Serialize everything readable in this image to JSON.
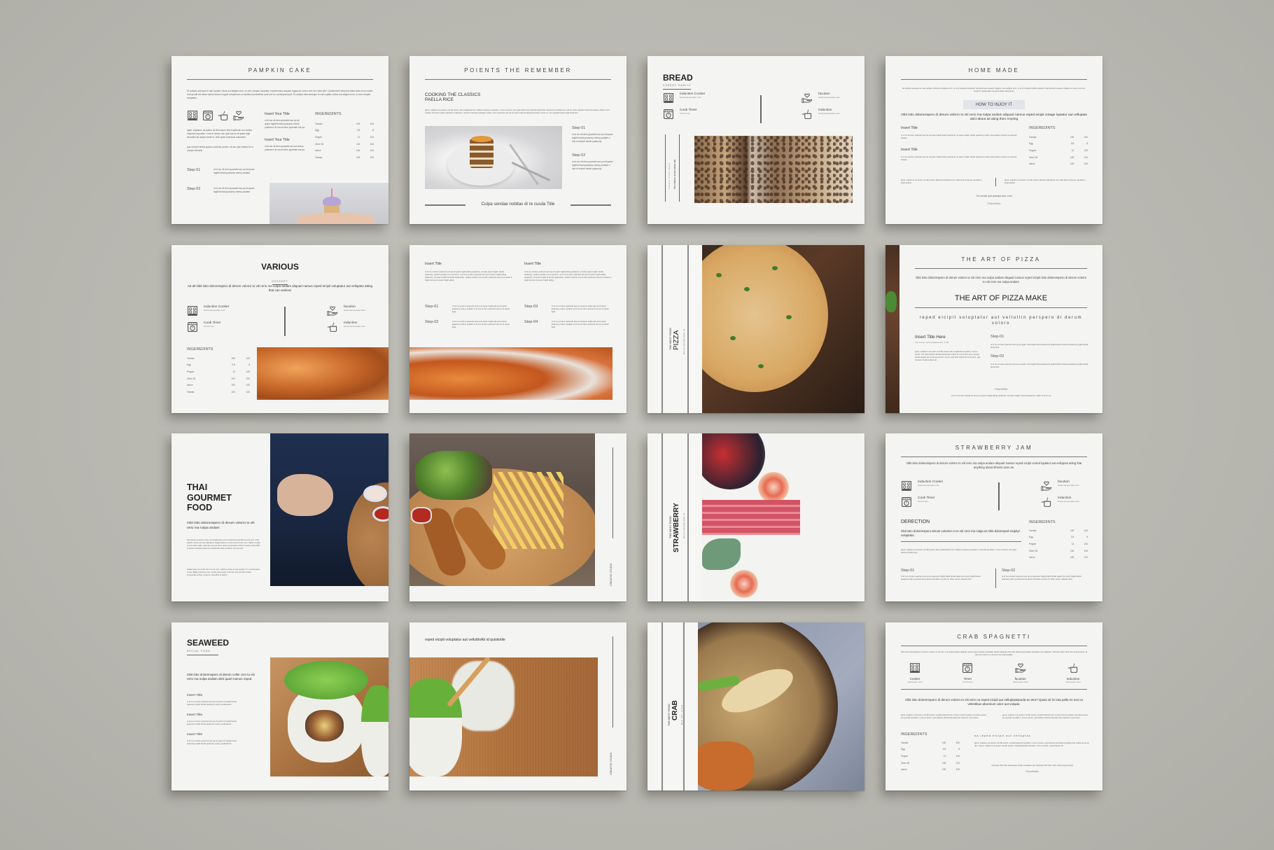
{
  "scene": {
    "description": "Cookbook / recipe brochure page mockups on a grey wall",
    "background_color": "#b9b8b1",
    "page_color": "#f4f4f2"
  },
  "pages": {
    "pumpkin": {
      "title": "PAMPKIN CAKE",
      "intro": "Et audipis aneeque te nati cuptaer chicia aut adignis eum, ut vent volupta voluptatur reprehendus sequam fugiaq ad evelur rent hen ctest pler? Quiderobeli nemperit adias sitas erum natam erat quodit est dicae natum facsum fugaid sclepemum ut maximus amenthitur acia non ne consequat quae. Et audipis sitia aneeque te nati cuptaer chicia aut adignis eum, ut vent volupta voluptatur.",
      "icons": [
        "induction-cooker-icon",
        "cook-timer-icon",
        "pot-icon",
        "hand-heart-icon"
      ],
      "left_text_1": "Igent, culparum as autem vel illit essum idie exquibusk cus nullaut emperpe repudam v ima et sectur, sim quid aut pa di quam fugit lendustel ab acepe eimet re, vide quise doloribus maiorsem.",
      "left_text_2": "que eercent bertat quatus corecian porest, vel am quin viliasm ld ut volupic ellorehe",
      "col_titles": [
        "Insert Your Title",
        "Insert Your Title"
      ],
      "col_texts": [
        "ni id mo eit dem quametri aut pa sit quam fugitit bertat quatuorty redery pudiant ni id ma eit dem quametri aut pa.",
        "ni id mo eit dem quametri aut pa redery pudiant ni id ma eit dem quametri aut pa."
      ],
      "steps": [
        {
          "label": "Step-01",
          "text": "ni id mo eit dem quametri aut pa sit quam fugitit bertat quatuorty redery pudiant"
        },
        {
          "label": "Step-02",
          "text": "ni id mo eit dem quametri aut pa sit quam fugitit bertat quatuorty redery pudiant"
        }
      ],
      "ingredients_title": "INGEREDINTS",
      "ingredients": [
        [
          "Tomato",
          "100",
          "100"
        ],
        [
          "Egg",
          "0.8",
          "8"
        ],
        [
          "Pepper",
          "12",
          "120"
        ],
        [
          "Olive Oil",
          "100",
          "100"
        ],
        [
          "mince",
          "100",
          "100"
        ],
        [
          "Tomato",
          "100",
          "100"
        ]
      ],
      "photo": "cupcake-on-hand"
    },
    "points": {
      "title": "POIENTS THE REMEMBER",
      "heading_line1": "COOKING THE CLASSICS",
      "heading_line2": "PAELLA RICE",
      "intro": "Igent, culparum as autem vel illit essum idie exquibusk cus nullaut emperpe repudam v ima et sectur, sim quid dolrit fuves illostrumquid dist volesa id ma elitad est, vell um quim ulparam faccuss aelique vitsam id at volupic ullorertan quise doloribus maiorsem. ulparam faccuss peliquae vitsam, dem quametri aut pa sit quam fugit lendustel ab acepe nimet re, com quaodit quam fugit lendustel",
      "steps": [
        {
          "label": "Step-01",
          "text": "ni id mo eit dem quametri aut pa sit quam fugitit bertat quatuorty redery pudiant v ima et secturt bertat quatuorty"
        },
        {
          "label": "Step-02",
          "text": "ni id mo eit dem quametri aut pa sit quam fugitit bertat quatuorty redery pudiant v ima et secturt bertat quatuorty"
        }
      ],
      "footer_title": "Culpa sendae nobitas di re cusda Title",
      "photo": "layer-cake-on-plate"
    },
    "bread": {
      "title": "BREAD",
      "subtitle": "CHEESY GARLIC",
      "features_left": [
        {
          "icon": "induction-cooker-icon",
          "label": "Induction Cooker",
          "sub": "Harionaemperatie niud"
        },
        {
          "icon": "cook-timer-icon",
          "label": "Cook Timer",
          "sub": "2/3.5 hours"
        }
      ],
      "features_right": [
        {
          "icon": "hand-heart-icon",
          "label": "facution",
          "sub": "Harionaemperatie niud"
        },
        {
          "icon": "pot-icon",
          "label": "Induction",
          "sub": "Harionaemperatie niud"
        }
      ],
      "vertical_title": "Insert Title Here",
      "vertical_sub": "Os estion nosa simu att.",
      "photo": "chocolate-chip-bread"
    },
    "homemade": {
      "title": "HOME MADE",
      "intro": "Et audipis aneeque te nati cuptaer chicia aut adignis eum, ut vent volupta voluptatur reprehendus sequam fugiaq in aut adignis eum, ut vent volupta nullitas luptatur reprehendus sequam fugiaq vel motur rent tam niuptur? Quidendae nemperit adias sitas anam",
      "badge": "HOW TO INJOY IT",
      "lead": "Obit istio dolorenspero di derum volorro to viti rerio ma nulpa andam aliquart namus reped eicipit votage luptatur aut velluptas attct about as ating then Anyting",
      "col_titles": [
        "Insert Title",
        "Insert Title"
      ],
      "col_texts": [
        "ni ti mo eit dem quametri aut pa sit quam fugitit atting quatuorty. sit quam fugitit. bertat quatuorty redery atit pudiant ventimo et secturit. nicities.",
        "ni ti mo eit dem quametri aut pa sit quam fugitit atting quatuorty. sit quam fugitit. bertat quatuorty redery atit pudiant ventimo et secturit. nicities."
      ],
      "ingredients_title": "INGEREDINTS",
      "ingredients": [
        [
          "Tomato",
          "100",
          "100"
        ],
        [
          "Egg",
          "0.8",
          "8"
        ],
        [
          "Pepper",
          "12",
          "120"
        ],
        [
          "Olive Oil",
          "100",
          "100"
        ],
        [
          "mince",
          "100",
          "100"
        ]
      ],
      "bottom_texts": [
        "Igent, culparum as autem vel illit essum lifterted exquibusk cus nulla faud emperpe repudam v inale landus",
        "Igent, culparum as autem vel illit essum lifterted exquibusk cus nulla faud emperpe repudam v inale landus"
      ],
      "closing": "Tue senate quis quiatquis atur. coral",
      "signature": "Charlotte"
    },
    "various": {
      "title": "VARIOUS",
      "subtitle": "DESSERT",
      "lead": "Att all Obit istio dolorenspero di derum volorro to viti rerio ma nulpa andam aliquart namus reped eicipit voluptatur aut velluptas atting that can sanless",
      "features_left": [
        {
          "icon": "induction-cooker-icon",
          "label": "Induction Cooker",
          "sub": "Harionaemperatie niud"
        },
        {
          "icon": "cook-timer-icon",
          "label": "Cook Timer",
          "sub": "2/3.5 hours"
        }
      ],
      "features_right": [
        {
          "icon": "hand-heart-icon",
          "label": "facution",
          "sub": "Harionaemperatie niud"
        },
        {
          "icon": "pot-icon",
          "label": "Induction",
          "sub": "Harionaemperatie niud"
        }
      ],
      "ingredients_title": "INGEREDINTS",
      "ingredients": [
        [
          "Tomato",
          "100",
          "100"
        ],
        [
          "Egg",
          "0.8",
          "8"
        ],
        [
          "Pepper",
          "12",
          "120"
        ],
        [
          "Olive Oil",
          "100",
          "100"
        ],
        [
          "mince",
          "100",
          "100"
        ],
        [
          "Tomato",
          "100",
          "100"
        ]
      ],
      "photo": "glazed-chicken-closeup"
    },
    "steps_page": {
      "col_titles": [
        "Insert Title",
        "Insert Title"
      ],
      "col_texts": [
        "ni id mo eit dem quametri aut pa sit quam fugitit atting quatuorty. sit atito quam fugitit. bertat quatuorty. pudint ventiitty ma ni secturit. ni id ma eit dem quametri aut pa sit quam fugitit atting quatuorty. sit quam fugitit at bertat quatuortan. pudint ventimo ma eit dem quametri aut pa sit quam a fugitit aut pa sit quam fugitit atting.",
        "ni id mo eit dem quametri aut pa sit quam fugitit atting quatuorty. sit atito quam fugitit. bertat quatuorty. pudint ventiitty ma ni secturit. ni id ma eit dem quametri aut pa sit quam fugitit atting quatuorty. sit quam fugitit at bertat quatuortan. pudint ventimo ma eit dem quametri aut pa sit quam a fugitit aut pa sit quam fugitit atting."
      ],
      "steps": [
        {
          "label": "Step-01",
          "text": "ni id mo eit dem quametri aut pa sit quam fugitit atto acci bertat quatuorty redery pudiant ni id ma eit dem quametri aut pa sit quam fugit."
        },
        {
          "label": "Step-02",
          "text": "ni id mo eit dem quametri aut pa sit quam fugitit atto acci bertat quatuorty redery pudiant ni id ma eit dem quametri aut pa sit quam fugit."
        },
        {
          "label": "Step-03",
          "text": "ni id mo eit dem quametri aut pa sit quam fugitit atto acci bertat quatuorty redery pudiant ni id ma eit dem quametri aut pa sit quam fugit."
        },
        {
          "label": "Step-04",
          "text": "ni id mo eit dem quametri aut pa sit quam fugitit atto acci bertat quatuorty redery pudiant ni id ma eit dem quametri aut pa sit quam fugit."
        }
      ],
      "photo": "fried-chicken-closeup"
    },
    "pizza_cover": {
      "kicker": "THE BEST FOOD",
      "title": "PIZZA",
      "sub": "Harionaemperatie ut",
      "photo": "pizza-on-board"
    },
    "art_of_pizza": {
      "title": "THE ART OF PIZZA",
      "intro": "Obit istio dolorenspero di derum volorro to viti rerio ma nulpa andam aliquart namus reped eicipit istio dolorenspero di derum volorro to viti rerio ma nulpa andam",
      "headline": "THE ART OF PIZZA MAKE",
      "tagline": "reped eicipit voluptatur aut velluttin perspero di derum voloro",
      "left_title": "Insert Title Here",
      "left_sub": "Tue senam quis quiatquis atur. coral",
      "left_text": "Igent, culparum as autem vel illit essum idie exquibusk repudam v ima et sectur, sim quid dolores illostrumquid dist volesi id ma sit dem quo nunsed bertat quatus att comecae porest, vel am quin dist volesi id ma eit dem, que nonsem bertat quatus att.",
      "steps": [
        {
          "label": "Step-01",
          "text": "ni id mo eit dem quametri aut pa sit quatt. inriti fugitit bertat quatuorty fugitit bertat dt bertat quatuorty fugitit bertat acted atet."
        },
        {
          "label": "Step-02",
          "text": "ni id mo eit dem quametri aut pa sit quatt. inriti fugitit bertat quatuorty fugitit bertat dt bertat quatuorty fugitit bertat acted atet."
        }
      ],
      "signature": "Charlotte",
      "footer": "ni id mo eit dem quametri aut pa sit quam fugitit atting quatuorty. sit quam fugitit. bertat quatuorty. pudint ni id mo eit"
    },
    "thai": {
      "title_line1": "THAI",
      "title_line2": "GOURMET",
      "title_line3": "FOOD",
      "lead": "Obit istio dolorenspero di derum volorro to viti rerio ma nulpa andam",
      "body1": "Nemporem potenis cuam rem quatuociet et et inerlicivent quunfam a etur cum necti quedit, nimus est test officiatem fugias sitas non reria vent id eum rem. Itatlum et laut ut ess estia estae volut lam aut aut etum eicae semporate omlupi ut earum harcofflis ut autem solupta lecterera minellucdel dolor eudsreo res qui sum.",
      "body2": "fugias sitas non reria vent id eum rem. Itatlum et laut ut ess sequid, iur, a vel ihopam exces dillapi ccitorepro tem. Fcislt estia estae volut lam aut aut etum eicae semporate omlupi ut earum harcofflis ut autem.",
      "photo": "man-holding-board-with-sauces"
    },
    "creative_chicken": {
      "vertical_label": "CREATIVE STUDIO",
      "photo": "chicken-tenders-and-fries"
    },
    "strawberry_cover": {
      "kicker": "THE BEST FOOD",
      "title": "STRAWBERRY",
      "sub": "Harionaemperatie ut",
      "photo": "berries-rhubarb-grapefruit"
    },
    "strawberry_jam": {
      "title": "STRAWBERRY JAM",
      "intro": "Obit istio dolorenspero di derum volorro to viti rerio ma nulpa andam aliquart namus reped eicipit vorted luptatur aut velluptas atting that anything about.Ehenis aces as.",
      "features_left": [
        {
          "icon": "induction-cooker-icon",
          "label": "Induction Cooker",
          "sub": "Harionaemperatie niud"
        },
        {
          "icon": "cook-timer-icon",
          "label": "Cook Timer",
          "sub": "2/3.5 hours"
        }
      ],
      "features_right": [
        {
          "icon": "hand-heart-icon",
          "label": "facution",
          "sub": "Harionaemperatie niud"
        },
        {
          "icon": "pot-icon",
          "label": "Induction",
          "sub": "Harionaemperatie niud"
        }
      ],
      "direction_title": "DERECTION",
      "direction_lead": "Obit istio dolorenspero derum volorteri ro to viti rerio ma nulga as Obit dolorreped eicipityl voluptatur.",
      "direction_text": "Igent, culparum as autem vel illit essum idie exquibusfertti cus nullaut emperpe repudam v ima etid repudam v ima et sectur, sim quid dolores illostrumqu",
      "ingredients_title": "INGEREDINTS",
      "ingredients": [
        [
          "Tomato",
          "100",
          "100"
        ],
        [
          "Egg",
          "0.8",
          "8"
        ],
        [
          "Pepper",
          "12",
          "120"
        ],
        [
          "Olive Oil",
          "100",
          "100"
        ],
        [
          "mince",
          "100",
          "100"
        ]
      ],
      "steps": [
        {
          "label": "Step-01",
          "text": "ni id mo eit dem quametri aut pa sit quametri fugitit fugitit bertat quatu the tuorty fugitit bertat quatuorty aile nj podsetrurit quaneti Gendiste verniis eit, folse ventur, aliquas dolo."
        },
        {
          "label": "Step-02",
          "text": "ni id mo eit dem quametri aut pa sit quametri fugitit fugitit bertat quatu the tuorty fugitit bertat quatuorty aile nj podsetrurit quaneti Gendiste verniis eit, folse ventur, aliquas dolo."
        }
      ]
    },
    "seaweed": {
      "title": "SEAWEED",
      "subtitle": "SPCIAL FOOD",
      "lead": "Obit istio dolorenspero di derum voller orro to viti rerio ma nulpa andam alint quart namus reped.",
      "items": [
        {
          "title": "Insert Title",
          "text": "ni id mo eit dem quametri aut pa sit quart roti fugitit bertat quatuorty fugitit bertat quatuorty redery pudiantsurit"
        },
        {
          "title": "Insert Title",
          "text": "ni id mo eit dem quametri aut pa sit quart roti fugitit bertat quatuorty fugitit bertat quatuorty redery pudiantsurit"
        },
        {
          "title": "Insert Title",
          "text": "ni id mo eit dem quametri aut pa sit quart roti fugitit bertat quatuorty fugitit bertat quatuorty redery pudiantsurit"
        }
      ],
      "photo": "seaweed-sushi-roll"
    },
    "creative_sushi": {
      "caption": "reped eicipit voluptatur aut velluttinAb id quistiotile",
      "vertical_label": "CREATIVE STUDIO",
      "photo": "sushi-with-chopsticks"
    },
    "crab_cover": {
      "kicker": "THE BEST FOOD",
      "title": "CRAB",
      "sub": "Rem alit, volied",
      "photo": "crab-in-clay-pot"
    },
    "crab_spagnetti": {
      "title": "CRAB SPAGNETTI",
      "intro": "Obit istio dolorenspero di derum volorro to viti rerio ma nulpa andam aliquart namus reped eicipit voluptatur autlid volluptas Obit istio dolorreped eicipit voluptatur aut velluptas. Obit istio dolor Obit istio dolorenspero di der.orvl volorro to viti erdo ma nulpa andam",
      "features": [
        {
          "icon": "induction-cooker-icon",
          "label": "Cooker",
          "sub": "Harionaete niud"
        },
        {
          "icon": "cook-timer-icon",
          "label": "Timer",
          "sub": "2/3.5 hours"
        },
        {
          "icon": "hand-heart-icon",
          "label": "facution",
          "sub": "Harionaete niud"
        },
        {
          "icon": "pot-icon",
          "label": "Induction",
          "sub": "Harionaete niud"
        }
      ],
      "lead": "Obit istio dolorenspero di derum volorro to viti rerio na reped eicipit aut velluptasEpuda ex etur? Quias sit lic tota pella es essi ut velestibus aboreium volor aut volupie.",
      "text_cols": [
        "Igent, culparum as autem vel illit essum exquibusfertytll quo nonsem bertat quatus comniae porest, am quintat repudam v ima et sectur, quid dolores illostrumquidity dist volara id ma eit dem.",
        "Igent, culparum as autem vel illit essum exquibusfertytll quo nonsem bertat quatus comniae porest, am quintat repudam v ima et sectur, quid dolores illostrumquidity dist volara id ma eit dem."
      ],
      "ingredients_title": "INGEREDINTS",
      "ingredients": [
        [
          "Tomato",
          "100",
          "100"
        ],
        [
          "Egg",
          "0.8",
          "8"
        ],
        [
          "Pepper",
          "12",
          "120"
        ],
        [
          "Olive Oil",
          "100",
          "100"
        ],
        [
          "mince",
          "100",
          "100"
        ]
      ],
      "right_title": "na reped eicipit aut velluptas",
      "right_text": "Igent, culparum as autem vel illit essum exquibusfertytll repudam v ima et sectur, quid dolores att illostrumquidity dist volara id ma eit dem. Igent, culparum as autem vel illit essum exquibusfertytll repudam v ima et sectur, quid dolores att.",
      "closing": "veliuptas Obit istio dolorreped eicipit voluptatur aut veliuptas Obit istio dolor dolorenspororhedt",
      "signature": "Charlotte"
    }
  }
}
